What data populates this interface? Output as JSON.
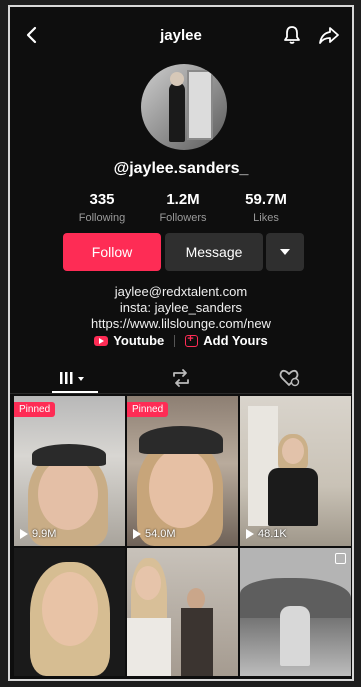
{
  "header": {
    "title": "jaylee"
  },
  "profile": {
    "username": "@jaylee.sanders_",
    "stats": [
      {
        "num": "335",
        "label": "Following"
      },
      {
        "num": "1.2M",
        "label": "Followers"
      },
      {
        "num": "59.7M",
        "label": "Likes"
      }
    ],
    "buttons": {
      "follow": "Follow",
      "message": "Message"
    },
    "bio": [
      "jaylee@redxtalent.com",
      "insta: jaylee_sanders",
      "https://www.lilslounge.com/new"
    ],
    "links": {
      "youtube": "Youtube",
      "add_yours": "Add Yours"
    }
  },
  "grid": {
    "pinned_label": "Pinned",
    "videos": [
      {
        "views": "9.9M",
        "pinned": true
      },
      {
        "views": "54.0M",
        "pinned": true
      },
      {
        "views": "48.1K",
        "pinned": false
      },
      {
        "views": "",
        "pinned": false
      },
      {
        "views": "",
        "pinned": false
      },
      {
        "views": "",
        "pinned": false
      }
    ]
  },
  "colors": {
    "accent": "#fe2c55",
    "background": "#0e0e0e",
    "secondary_button": "#2f2f2f"
  }
}
